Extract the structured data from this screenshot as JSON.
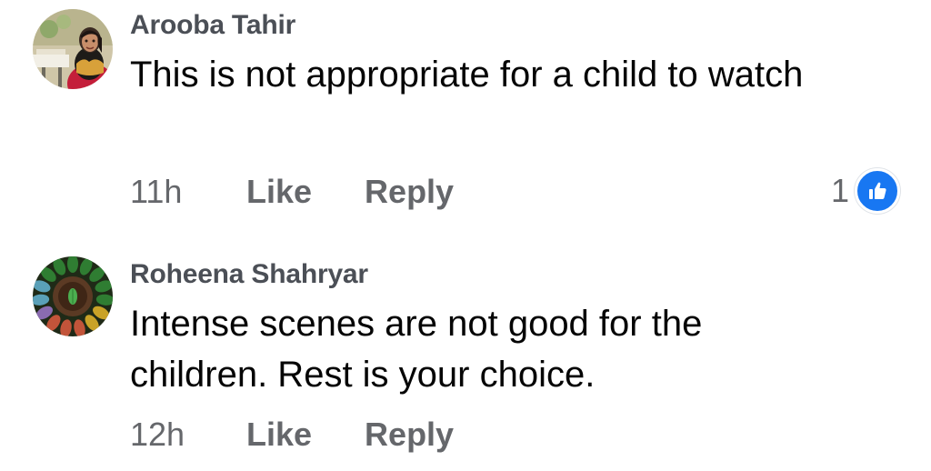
{
  "comments": [
    {
      "author": "Arooba Tahir",
      "text": "This is not appropriate for a child to watch",
      "time": "11h",
      "like_label": "Like",
      "reply_label": "Reply",
      "reaction_count": "1",
      "reaction_icon": "thumbs-up-icon",
      "reaction_color": "#1877f2"
    },
    {
      "author": "Roheena Shahryar",
      "text": "Intense scenes are not good for the children. Rest is your choice.",
      "time": "12h",
      "like_label": "Like",
      "reply_label": "Reply"
    }
  ]
}
